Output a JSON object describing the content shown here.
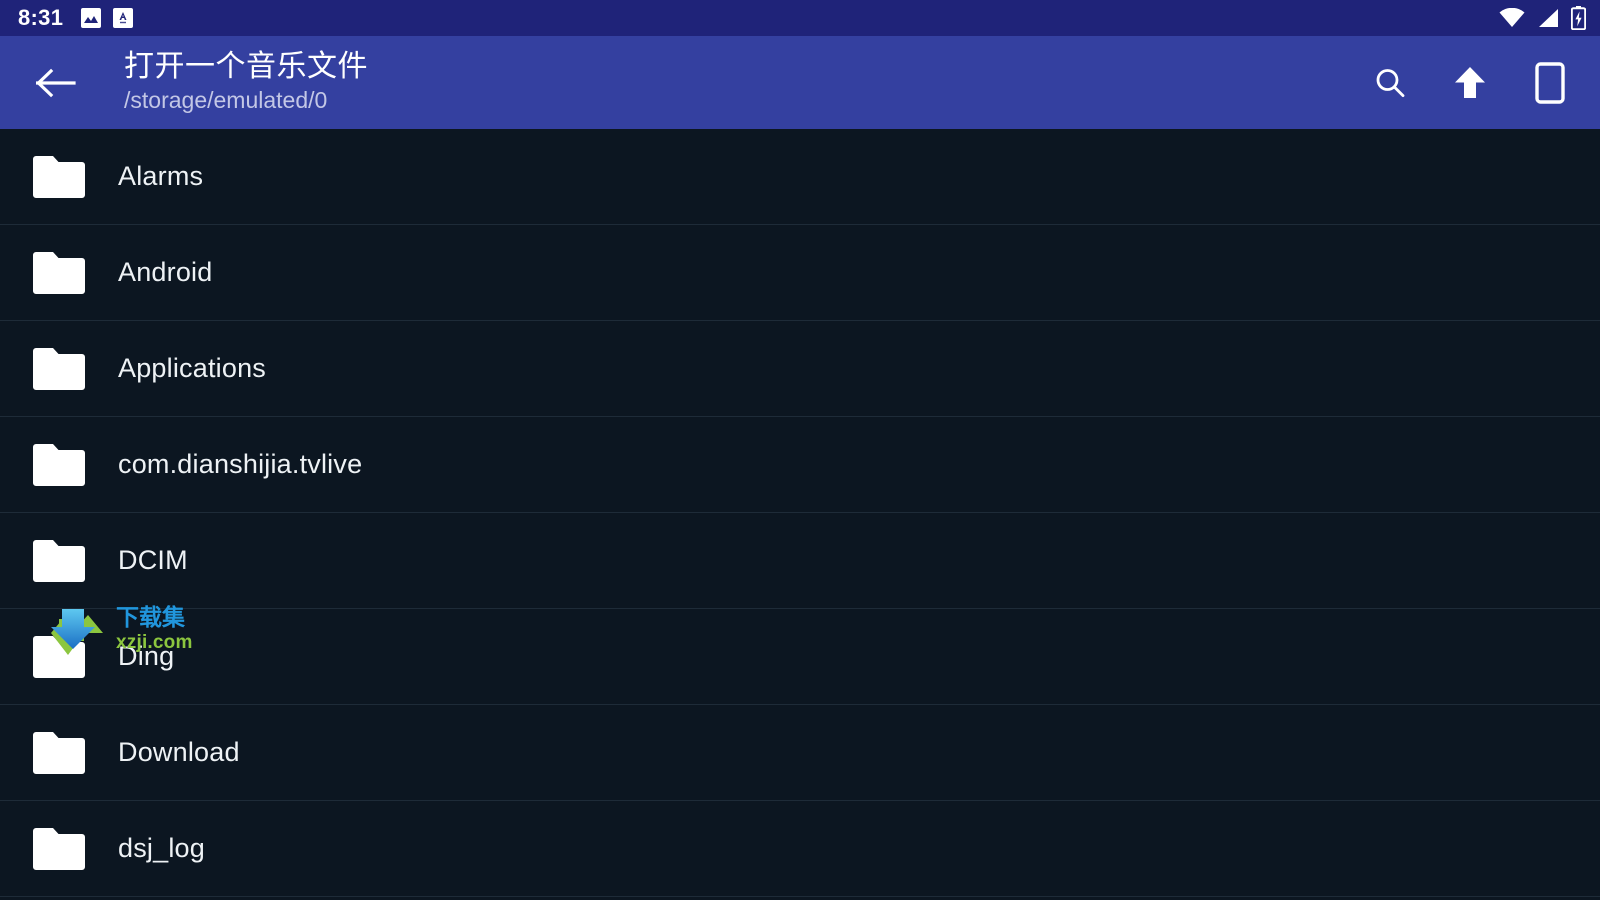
{
  "status_bar": {
    "clock": "8:31",
    "notifications": [
      {
        "name": "image-notification-icon",
        "glyph": "image"
      },
      {
        "name": "text-notification-icon",
        "glyph": "text"
      }
    ],
    "indicators": [
      {
        "name": "wifi-icon",
        "glyph": "wifi"
      },
      {
        "name": "cell-signal-icon",
        "glyph": "signal"
      },
      {
        "name": "battery-charging-icon",
        "glyph": "battery-charging"
      }
    ],
    "background_color": "#1f2379"
  },
  "app_bar": {
    "back_label": "←",
    "title": "打开一个音乐文件",
    "subtitle": "/storage/emulated/0",
    "background_color": "#3440a0",
    "actions": [
      {
        "name": "search-button",
        "icon": "search-icon"
      },
      {
        "name": "go-up-button",
        "icon": "arrow-up-icon"
      },
      {
        "name": "internal-storage-button",
        "icon": "phone-icon"
      }
    ]
  },
  "file_list": {
    "background_color": "#0c1621",
    "divider_color": "#1e2b38",
    "text_color": "#eef2f5",
    "items": [
      {
        "name": "Alarms",
        "type": "folder"
      },
      {
        "name": "Android",
        "type": "folder"
      },
      {
        "name": "Applications",
        "type": "folder"
      },
      {
        "name": "com.dianshijia.tvlive",
        "type": "folder"
      },
      {
        "name": "DCIM",
        "type": "folder"
      },
      {
        "name": "Ding",
        "type": "folder"
      },
      {
        "name": "Download",
        "type": "folder"
      },
      {
        "name": "dsj_log",
        "type": "folder"
      }
    ]
  },
  "watermark": {
    "cn_text": "下载集",
    "en_text": "xzji.com",
    "cn_color": "#2196dd",
    "en_color": "#8cc63f"
  }
}
